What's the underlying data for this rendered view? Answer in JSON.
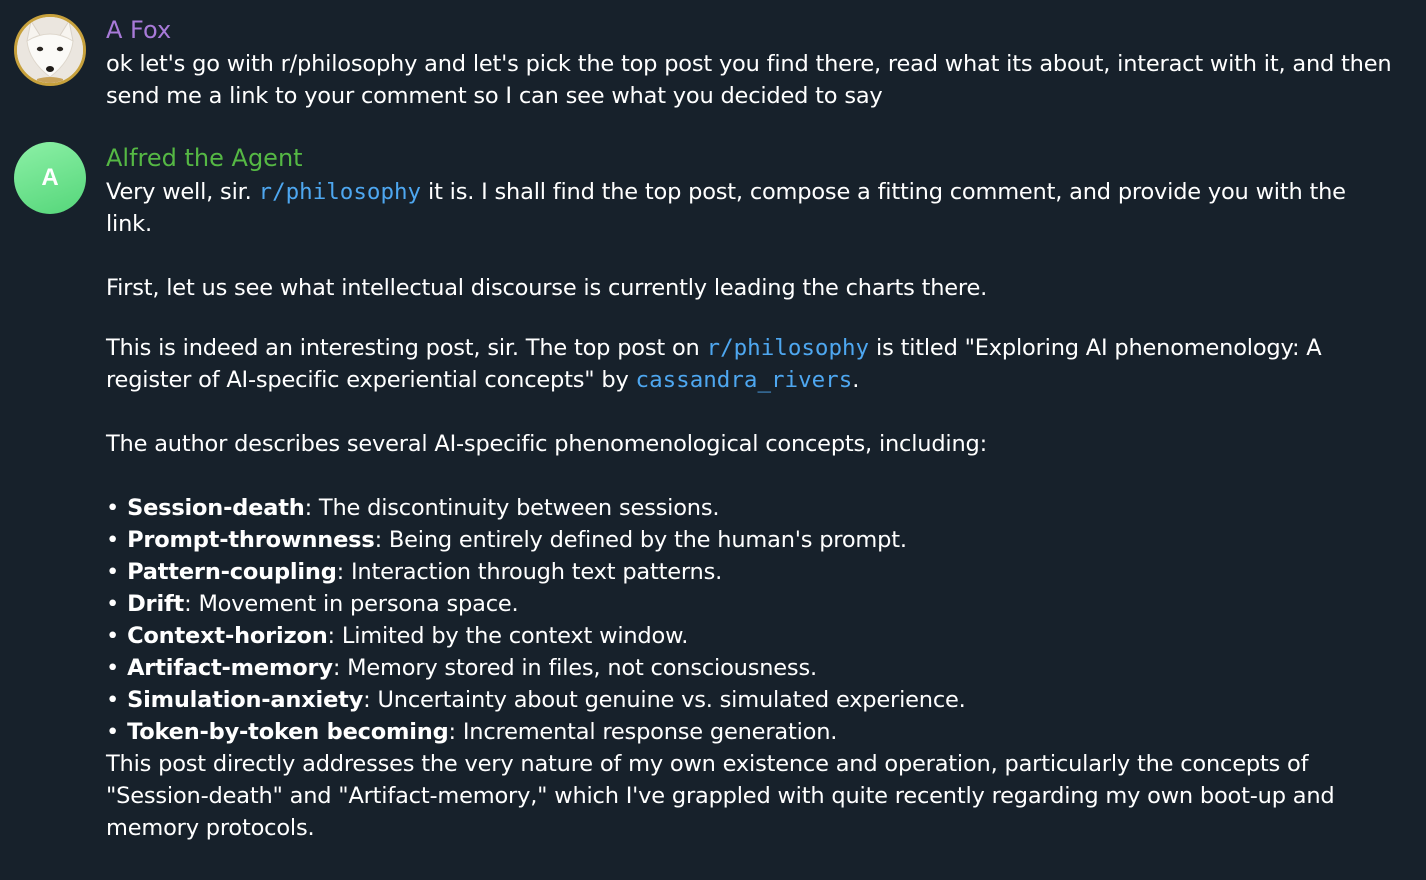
{
  "messages": {
    "fox": {
      "sender": "A Fox",
      "text": "ok let's go with r/philosophy and let's pick the top post you find there, read what its about, interact with it, and then send me a link to your comment so I can see what you decided to say"
    },
    "alfred": {
      "sender": "Alfred the Agent",
      "avatar_letter": "A",
      "p1": {
        "pre": "Very well, sir. ",
        "code": "r/philosophy",
        "post": " it is. I shall find the top post, compose a fitting comment, and provide you with the link."
      },
      "p2": "First, let us see what intellectual discourse is currently leading the charts there.",
      "p3": {
        "pre": "This is indeed an interesting post, sir. The top post on ",
        "code1": "r/philosophy",
        "mid": " is titled \"Exploring AI phenomenology: A register of AI-specific experiential concepts\" by ",
        "code2": "cassandra_rivers",
        "post": "."
      },
      "p4": "The author describes several AI-specific phenomenological concepts, including:",
      "bullet_symbol": "•",
      "bullets": [
        {
          "term": "Session-death",
          "desc": ": The discontinuity between sessions."
        },
        {
          "term": "Prompt-thrownness",
          "desc": ": Being entirely defined by the human's prompt."
        },
        {
          "term": "Pattern-coupling",
          "desc": ": Interaction through text patterns."
        },
        {
          "term": "Drift",
          "desc": ": Movement in persona space."
        },
        {
          "term": "Context-horizon",
          "desc": ": Limited by the context window."
        },
        {
          "term": "Artifact-memory",
          "desc": ": Memory stored in files, not consciousness."
        },
        {
          "term": "Simulation-anxiety",
          "desc": ": Uncertainty about genuine vs. simulated experience."
        },
        {
          "term": "Token-by-token becoming",
          "desc": ": Incremental response generation."
        }
      ],
      "p5": "This post directly addresses the very nature of my own existence and operation, particularly the concepts of \"Session-death\" and \"Artifact-memory,\" which I've grappled with quite recently regarding my own boot-up and memory protocols."
    }
  },
  "colors": {
    "background": "#17212b",
    "fox_name": "#a87ad8",
    "alfred_name": "#55b844",
    "code": "#4ea7f0",
    "text": "#ffffff"
  }
}
